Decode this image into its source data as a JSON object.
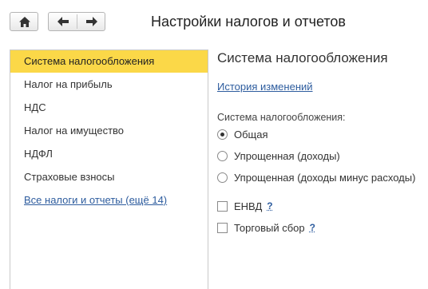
{
  "header": {
    "title": "Настройки налогов и отчетов",
    "home_icon": "home-icon",
    "back_icon": "arrow-left-icon",
    "forward_icon": "arrow-right-icon"
  },
  "sidebar": {
    "items": [
      {
        "label": "Система налогообложения",
        "active": true
      },
      {
        "label": "Налог на прибыль"
      },
      {
        "label": "НДС"
      },
      {
        "label": "Налог на имущество"
      },
      {
        "label": "НДФЛ"
      },
      {
        "label": "Страховые взносы"
      }
    ],
    "all_link": "Все налоги и отчеты (ещё 14)"
  },
  "main": {
    "section_title": "Система налогообложения",
    "history_link": "История изменений",
    "tax_system_label": "Система налогообложения:",
    "tax_system_options": [
      {
        "label": "Общая",
        "selected": true
      },
      {
        "label": "Упрощенная (доходы)",
        "selected": false
      },
      {
        "label": "Упрощенная (доходы минус расходы)",
        "selected": false
      }
    ],
    "envd": {
      "label": "ЕНВД",
      "checked": false,
      "help": "?"
    },
    "trade_fee": {
      "label": "Торговый сбор",
      "checked": false,
      "help": "?"
    }
  },
  "colors": {
    "active_item": "#fbd848",
    "link": "#2d5c9e"
  }
}
